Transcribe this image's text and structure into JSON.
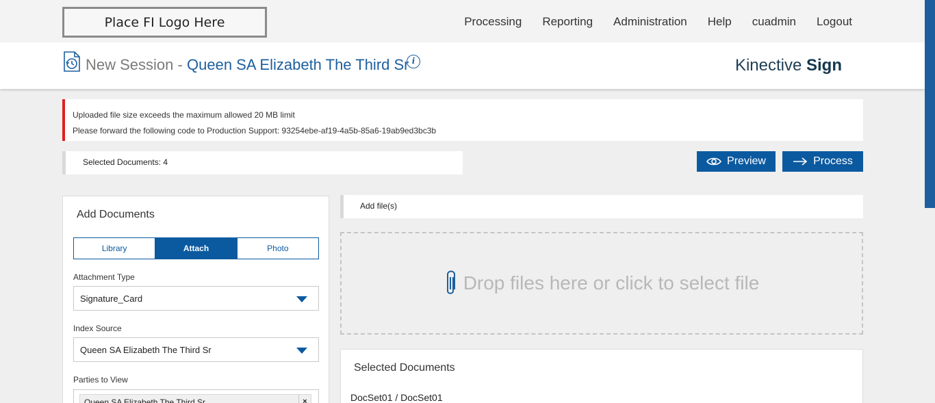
{
  "topbar": {
    "logo_text": "Place FI Logo Here",
    "nav": [
      "Processing",
      "Reporting",
      "Administration",
      "Help",
      "cuadmin",
      "Logout"
    ]
  },
  "header": {
    "session_prefix": "New Session -",
    "session_name": "Queen SA Elizabeth The Third Sr",
    "info_glyph": "i",
    "brand_light": "Kinective",
    "brand_bold": "Sign"
  },
  "alert": {
    "line1": "Uploaded file size exceeds the maximum allowed 20 MB limit",
    "line2": "Please forward the following code to Production Support: 93254ebe-af19-4a5b-85a6-19ab9ed3bc3b",
    "color": "#e02020"
  },
  "selected_count": "Selected Documents: 4",
  "actions": {
    "preview_label": "Preview",
    "process_label": "Process",
    "color": "#0b5aa0"
  },
  "add_documents": {
    "title": "Add Documents",
    "tabs": [
      {
        "label": "Library",
        "active": false
      },
      {
        "label": "Attach",
        "active": true
      },
      {
        "label": "Photo",
        "active": false
      }
    ],
    "attachment_type_label": "Attachment Type",
    "attachment_type_value": "Signature_Card",
    "index_source_label": "Index Source",
    "index_source_value": "Queen SA Elizabeth The Third Sr",
    "parties_label": "Parties to View",
    "parties": [
      "Queen SA Elizabeth The Third Sr"
    ],
    "remove_glyph": "×"
  },
  "upload": {
    "add_files_label": "Add file(s)",
    "drop_text": "Drop files here or click to select file",
    "icon": "paperclip-icon"
  },
  "selected_documents": {
    "title": "Selected Documents",
    "items": [
      "DocSet01 / DocSet01"
    ]
  }
}
